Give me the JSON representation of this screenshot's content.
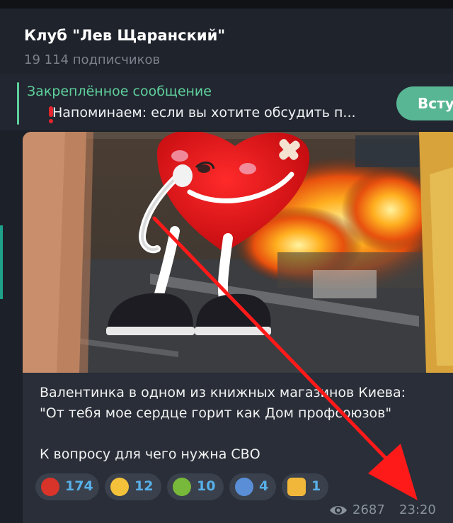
{
  "channel": {
    "name": "Клуб \"Лев Щаранский\"",
    "subscribers": "19 114 подписчиков"
  },
  "pinned": {
    "title": "Закреплённое сообщение",
    "text": "Напоминаем: если вы хотите обсудить п..."
  },
  "join_button": "Всту",
  "message": {
    "lines": [
      "Валентинка в одном из книжных магазинов Киева:",
      "\"От тебя мое сердце горит как Дом профсоюзов\"",
      "К вопросу для чего нужна СВО"
    ],
    "reactions": [
      {
        "emoji": "cursing-face-icon",
        "count": "174"
      },
      {
        "emoji": "crying-face-icon",
        "count": "12"
      },
      {
        "emoji": "vomiting-face-icon",
        "count": "10"
      },
      {
        "emoji": "screaming-face-icon",
        "count": "4"
      },
      {
        "emoji": "thumbs-up-icon",
        "count": "1"
      }
    ],
    "views": "2687",
    "time": "23:20"
  },
  "colors": {
    "background": "#1c2028",
    "accent_green": "#5fcf9c",
    "button": "#58b695",
    "reaction_count": "#58b0e8",
    "annotation_arrow": "#ff1a1a"
  }
}
